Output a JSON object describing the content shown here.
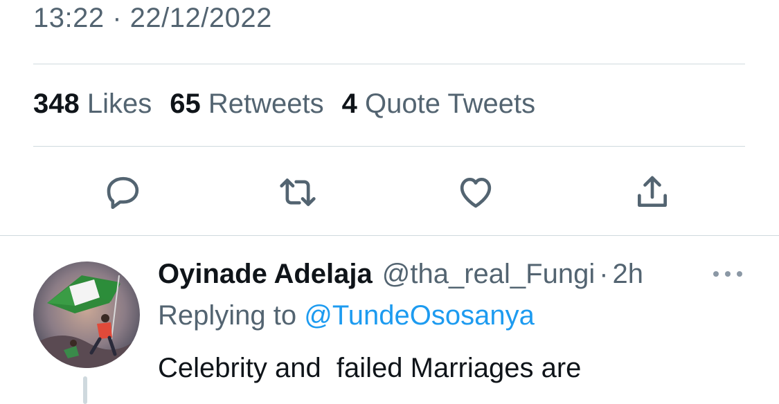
{
  "tweet": {
    "timestamp": "13:22 · 22/12/2022",
    "stats": [
      {
        "count": "348",
        "label": "Likes"
      },
      {
        "count": "65",
        "label": "Retweets"
      },
      {
        "count": "4",
        "label": "Quote Tweets"
      }
    ],
    "actions": [
      "reply-icon",
      "retweet-icon",
      "like-icon",
      "share-icon"
    ]
  },
  "reply": {
    "name": "Oyinade Adelaja",
    "handle": "@tha_real_Fungi",
    "separator": "·",
    "time": "2h",
    "replying_prefix": "Replying to",
    "replying_to": "@TundeOsosanya",
    "text": "Celebrity and  failed Marriages are"
  },
  "colors": {
    "secondary_text": "#536471",
    "link": "#1d9bf0",
    "divider": "#cfd9de"
  }
}
